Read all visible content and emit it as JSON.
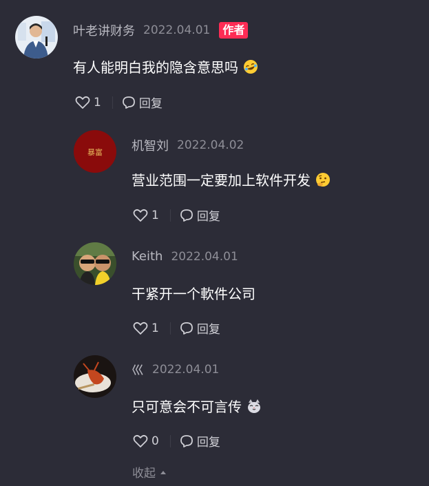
{
  "comments": [
    {
      "username": "叶老讲财务",
      "date": "2022.04.01",
      "badge": "作者",
      "text": "有人能明白我的隐含意思吗",
      "emoji": "rolling-laughing-emoji",
      "likes": "1",
      "reply_label": "回复"
    },
    {
      "username": "机智刘",
      "date": "2022.04.02",
      "text": "营业范围一定要加上软件开发",
      "emoji": "thinking-emoji",
      "likes": "1",
      "reply_label": "回复",
      "avatar_text": "暴富"
    },
    {
      "username": "Keith",
      "date": "2022.04.01",
      "text": "干紧开一个軟件公司",
      "likes": "1",
      "reply_label": "回复"
    },
    {
      "username": "巛",
      "date": "2022.04.01",
      "text": "只可意会不可言传",
      "emoji": "cat-emoji",
      "likes": "0",
      "reply_label": "回复"
    }
  ],
  "collapse_label": "收起",
  "colors": {
    "background": "#2c2c37",
    "badge": "#fe2c55",
    "secondary_text": "#8e8e97"
  }
}
